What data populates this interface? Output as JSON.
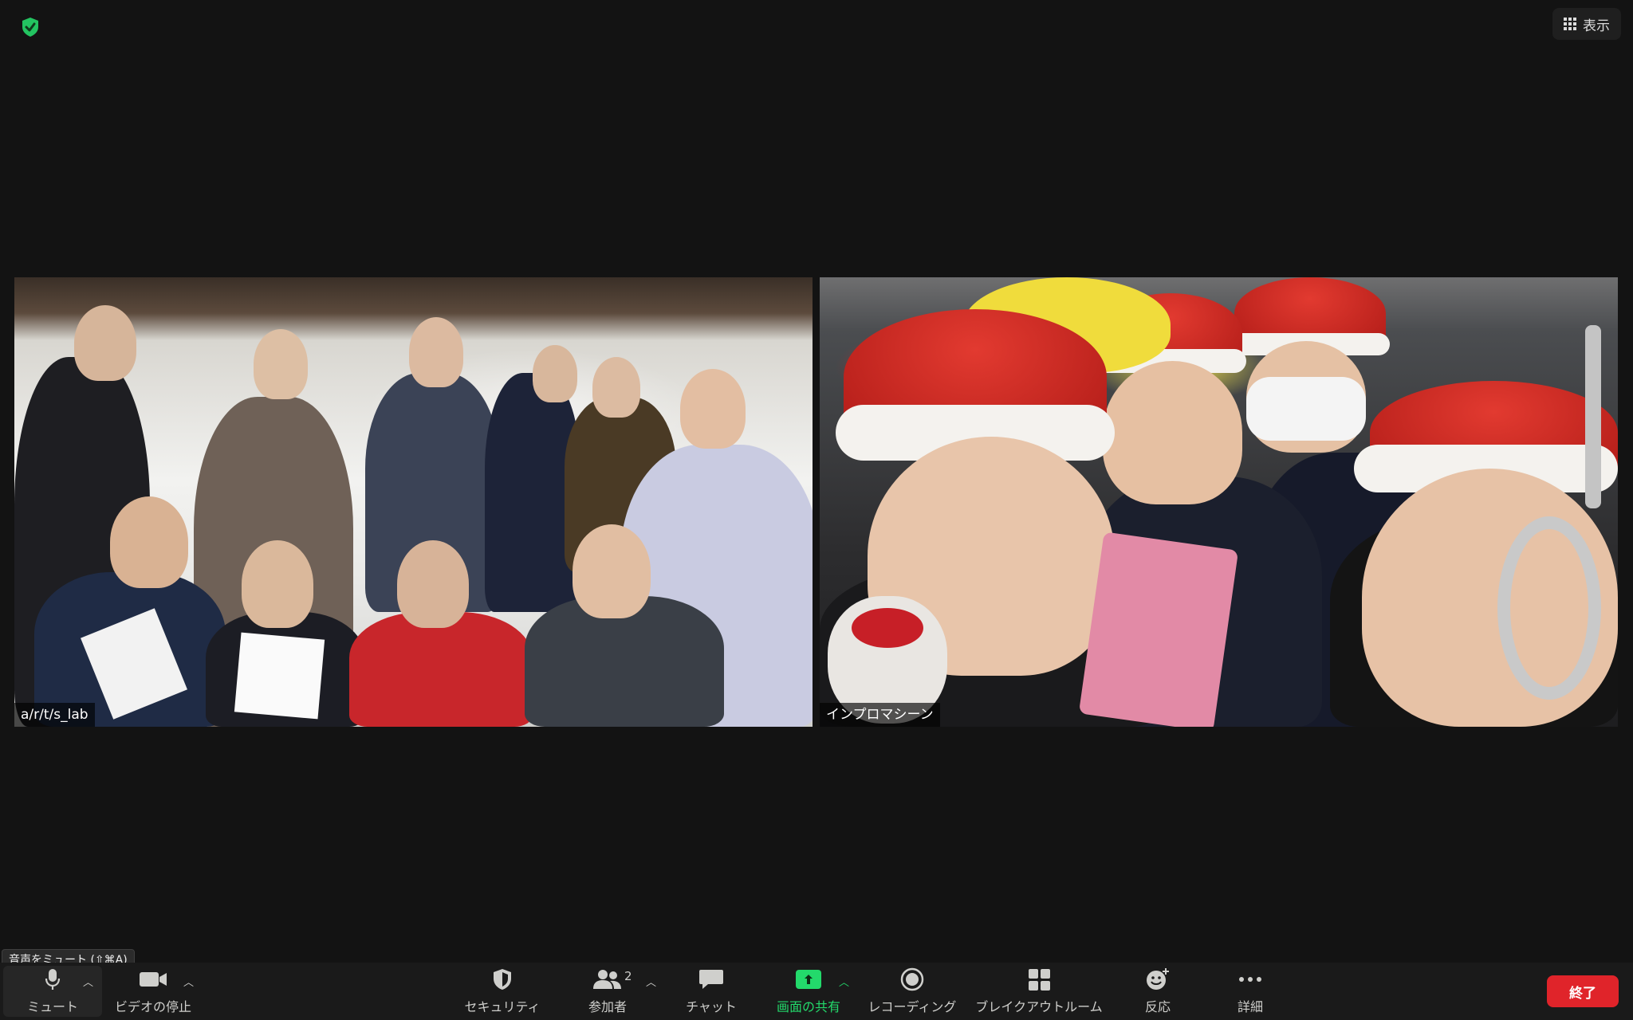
{
  "window": {
    "view_label": "表示"
  },
  "tiles": [
    {
      "name": "a/r/t/s_lab"
    },
    {
      "name": "インプロマシーン"
    }
  ],
  "tooltip": "音声をミュート (⇧⌘A)",
  "toolbar": {
    "mute": "ミュート",
    "video": "ビデオの停止",
    "security": "セキュリティ",
    "participants": "参加者",
    "participants_count": "2",
    "chat": "チャット",
    "share": "画面の共有",
    "recording": "レコーディング",
    "breakout": "ブレイクアウトルーム",
    "reactions": "反応",
    "more": "詳細",
    "end": "終了"
  },
  "colors": {
    "accent_green": "#23d96b",
    "end_red": "#e0242a",
    "background": "#131313"
  }
}
